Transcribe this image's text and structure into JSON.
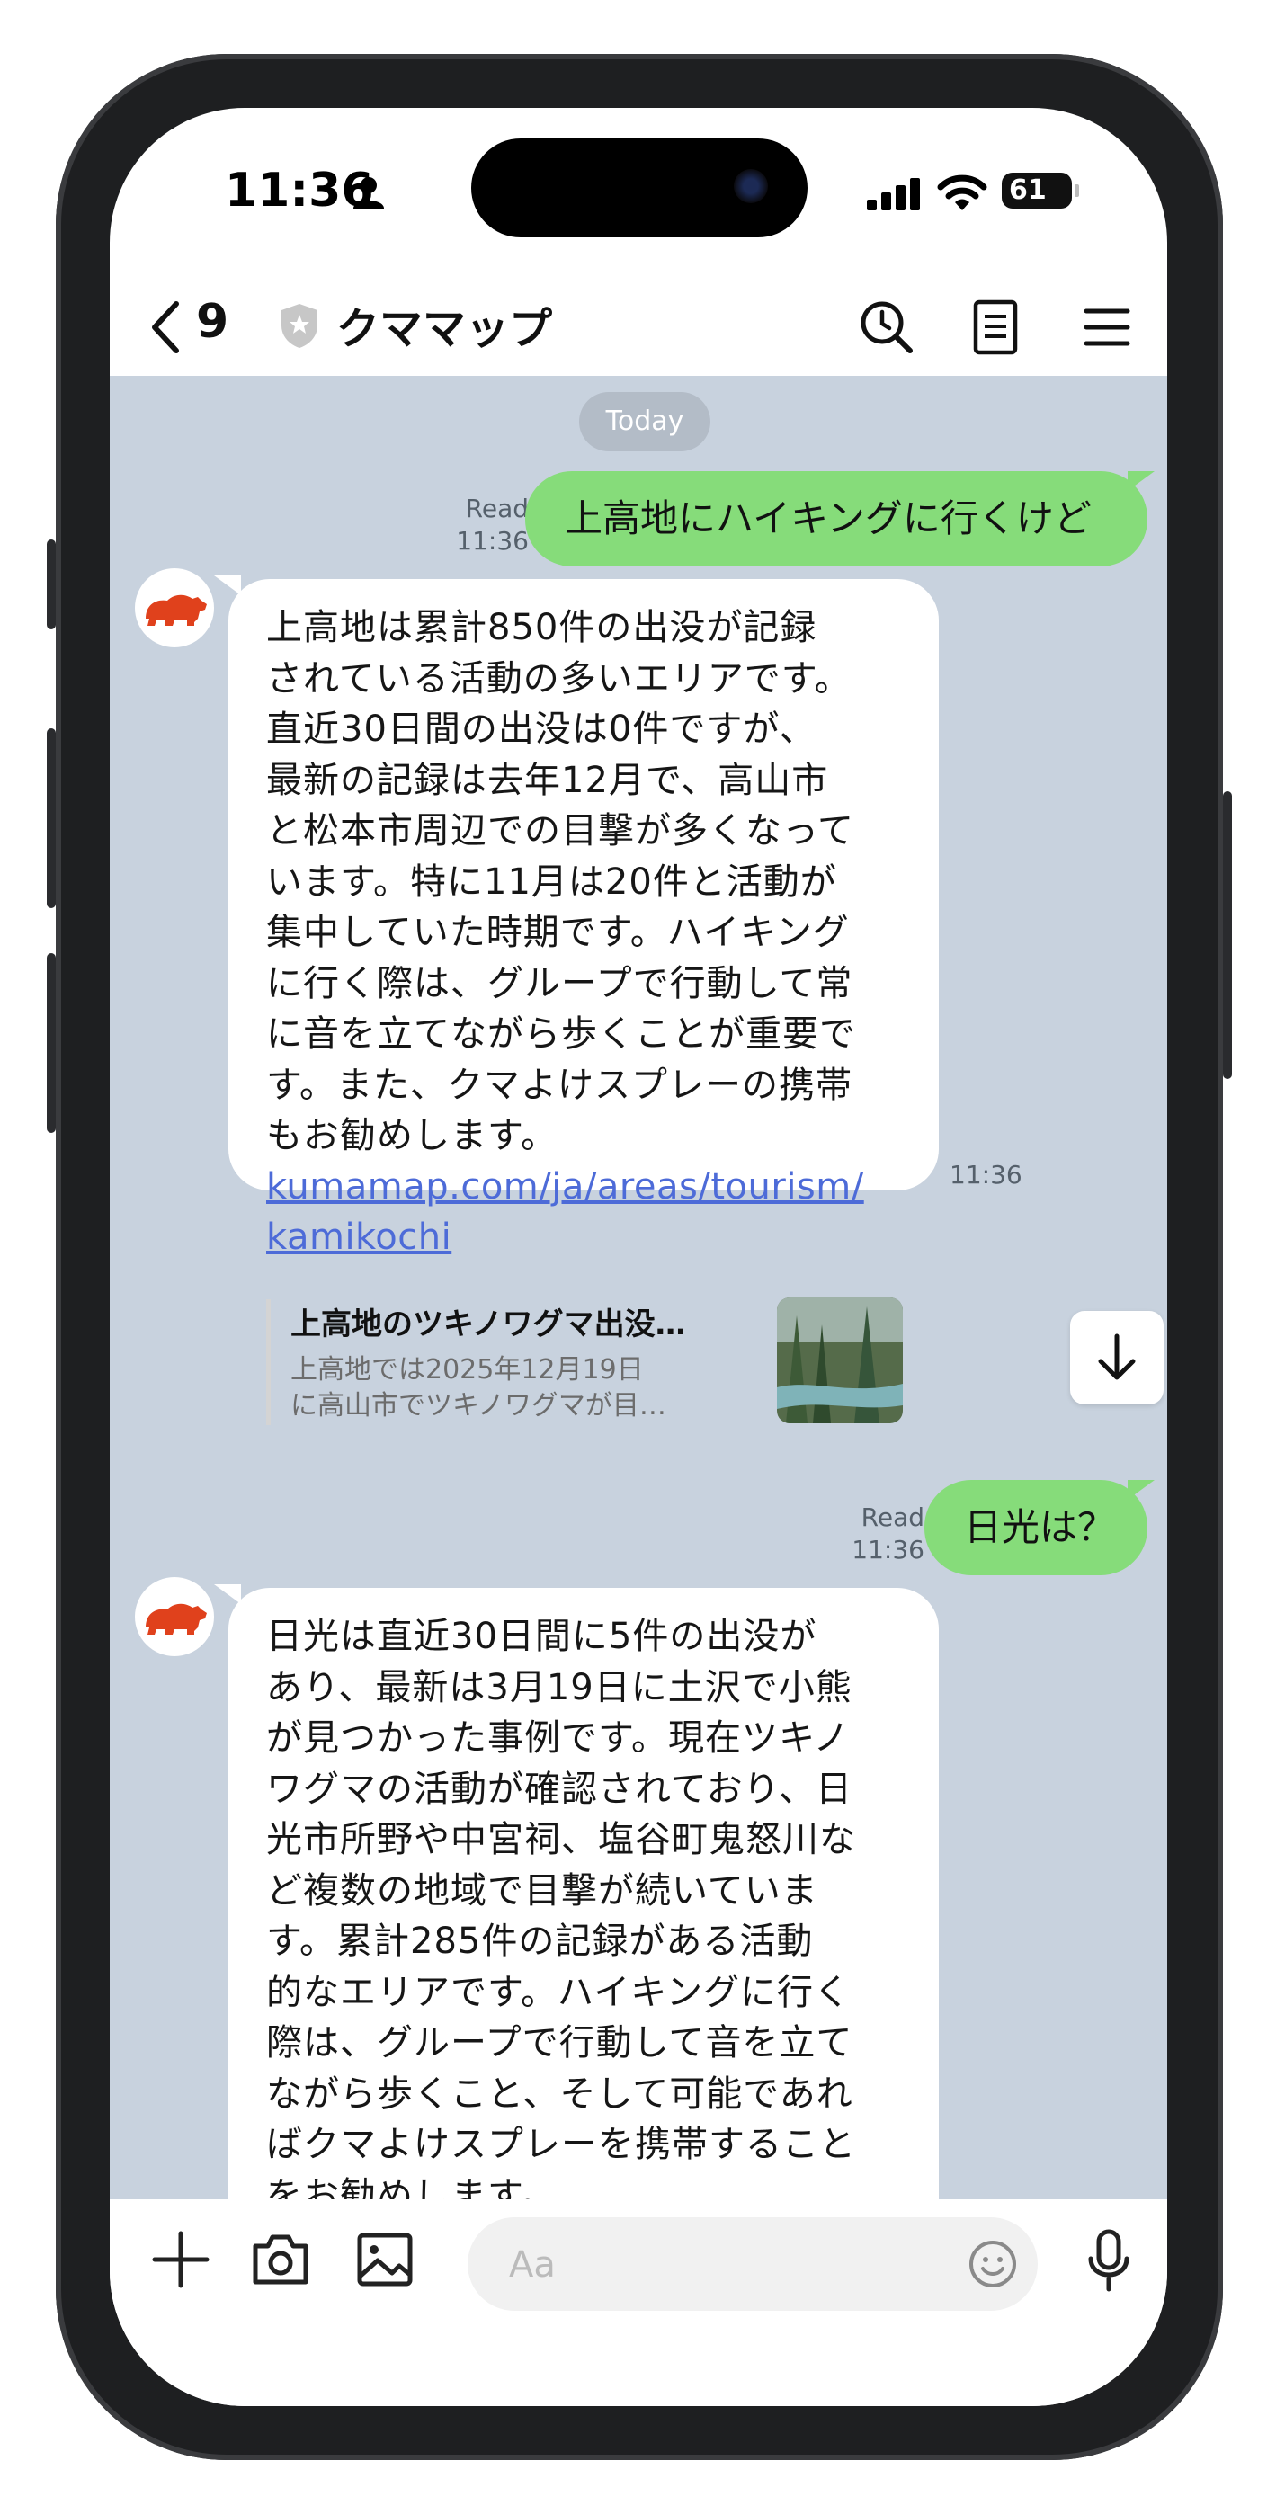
{
  "status_bar": {
    "time": "11:36",
    "battery": "61"
  },
  "header": {
    "back_count": "9",
    "title": "クママップ"
  },
  "chat": {
    "date_separator": "Today",
    "messages": [
      {
        "type": "sent",
        "read": "Read",
        "time": "11:36",
        "text": "上高地にハイキングに行くけど"
      },
      {
        "type": "received",
        "text": "上高地は累計850件の出没が記録\nされている活動の多いエリアです。\n直近30日間の出没は0件ですが、\n最新の記録は去年12月で、高山市\nと松本市周辺での目撃が多くなって\nいます。特に11月は20件と活動が\n集中していた時期です。ハイキング\nに行く際は、グループで行動して常\nに音を立てながら歩くことが重要で\nす。また、クマよけスプレーの携帯\nもお勧めします。",
        "link_line1": "kumamap.com/ja/areas/tourism/",
        "link_line2": "kamikochi",
        "card": {
          "title": "上高地のツキノワグマ出没…",
          "desc_line1": "上高地では2025年12月19日",
          "desc_line2": "に高山市でツキノワグマが目…"
        },
        "time": "11:36"
      },
      {
        "type": "sent",
        "read": "Read",
        "time": "11:36",
        "text": "日光は？"
      },
      {
        "type": "received",
        "text": "日光は直近30日間に5件の出没が\nあり、最新は3月19日に土沢で小熊\nが見つかった事例です。現在ツキノ\nワグマの活動が確認されており、日\n光市所野や中宮祠、塩谷町鬼怒川な\nど複数の地域で目撃が続いていま\nす。累計285件の記録がある活動\n的なエリアです。ハイキングに行く\n際は、グループで行動して音を立て\nながら歩くこと、そして可能であれ\nばクマよけスプレーを携帯すること\nをお勧めします。"
      }
    ]
  },
  "input": {
    "placeholder": "Aa"
  },
  "colors": {
    "chat_bg": "#c8d2de",
    "sent_bubble": "#86dc7a",
    "link": "#4d6bd8",
    "bear": "#e0411c"
  },
  "icons": [
    "person-icon",
    "signal-icon",
    "wifi-icon",
    "battery-icon",
    "back-chevron-icon",
    "official-shield-icon",
    "search-clock-icon",
    "notes-icon",
    "menu-icon",
    "bear-avatar-icon",
    "arrow-down-icon",
    "plus-icon",
    "camera-icon",
    "image-icon",
    "emoji-icon",
    "microphone-icon"
  ]
}
